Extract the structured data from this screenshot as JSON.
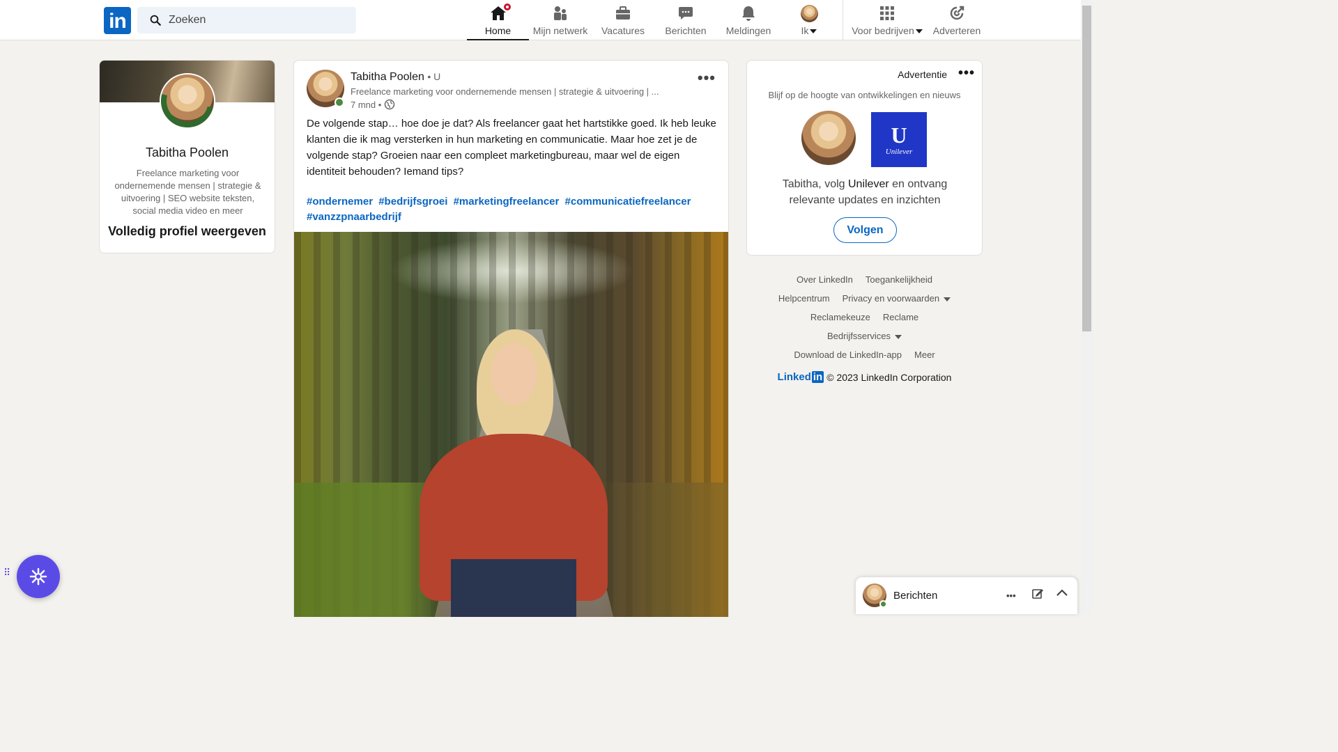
{
  "nav": {
    "logo": "in",
    "search_placeholder": "Zoeken",
    "items": [
      {
        "label": "Home",
        "icon": "home-icon"
      },
      {
        "label": "Mijn netwerk",
        "icon": "network-icon"
      },
      {
        "label": "Vacatures",
        "icon": "briefcase-icon"
      },
      {
        "label": "Berichten",
        "icon": "messaging-icon"
      },
      {
        "label": "Meldingen",
        "icon": "bell-icon"
      },
      {
        "label": "Ik",
        "icon": "avatar"
      },
      {
        "label": "Voor bedrijven",
        "icon": "grid-icon"
      },
      {
        "label": "Adverteren",
        "icon": "advertise-icon"
      }
    ]
  },
  "profile": {
    "name": "Tabitha Poolen",
    "headline": "Freelance marketing voor ondernemende mensen | strategie & uitvoering | SEO website teksten, social media video en meer",
    "view_link": "Volledig profiel weergeven"
  },
  "post": {
    "author": "Tabitha Poolen",
    "degree": "• U",
    "subtitle": "Freelance marketing voor ondernemende mensen | strategie & uitvoering | ...",
    "time": "7 mnd •",
    "body": "De volgende stap… hoe doe je dat? Als freelancer gaat het hartstikke goed. Ik heb leuke klanten die ik mag versterken in hun marketing en communicatie. Maar hoe zet je de volgende stap? Groeien naar een compleet marketingbureau, maar wel de eigen identiteit behouden? Iemand tips?",
    "hashtags": [
      "#ondernemer",
      "#bedrijfsgroei",
      "#marketingfreelancer",
      "#communicatiefreelancer",
      "#vanzzpnaarbedrijf"
    ],
    "more": "•••"
  },
  "ad": {
    "label": "Advertentie",
    "more": "•••",
    "title": "Blijf op de hoogte van ontwikkelingen en nieuws",
    "company_logo_text": "Unilever",
    "text_prefix": "Tabitha, volg ",
    "company": "Unilever",
    "text_suffix": " en ontvang relevante updates en inzichten",
    "follow": "Volgen"
  },
  "footer": {
    "links": {
      "about": "Over LinkedIn",
      "accessibility": "Toegankelijkheid",
      "help": "Helpcentrum",
      "privacy": "Privacy en voorwaarden",
      "adchoices": "Reclamekeuze",
      "advertising": "Reclame",
      "business": "Bedrijfsservices",
      "app": "Download de LinkedIn-app",
      "more": "Meer"
    },
    "logo": "Linked",
    "logo_in": "in",
    "copyright": "© 2023 LinkedIn Corporation"
  },
  "messaging": {
    "title": "Berichten",
    "more": "•••"
  },
  "colors": {
    "brand": "#0a66c2",
    "background": "#f4f2ee",
    "notification": "#cb112d",
    "online": "#4c8a3f",
    "widget": "#5b4be6"
  }
}
